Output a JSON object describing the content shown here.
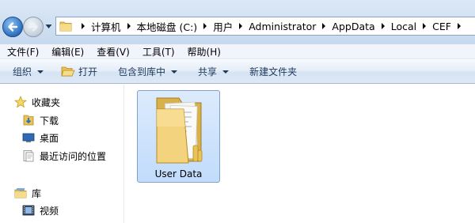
{
  "address": {
    "crumbs": [
      "计算机",
      "本地磁盘 (C:)",
      "用户",
      "Administrator",
      "AppData",
      "Local",
      "CEF"
    ]
  },
  "menu": [
    "文件(F)",
    "编辑(E)",
    "查看(V)",
    "工具(T)",
    "帮助(H)"
  ],
  "toolbar": {
    "organize": "组织",
    "open": "打开",
    "include_library": "包含到库中",
    "share": "共享",
    "new_folder": "新建文件夹"
  },
  "nav": {
    "favorites": "收藏夹",
    "downloads": "下载",
    "desktop": "桌面",
    "recent": "最近访问的位置",
    "libraries": "库",
    "videos": "视频"
  },
  "content": {
    "items": [
      {
        "name": "User Data",
        "type": "folder"
      }
    ]
  },
  "colors": {
    "selection": "#cce8ff",
    "folder": "#f3d37e"
  }
}
